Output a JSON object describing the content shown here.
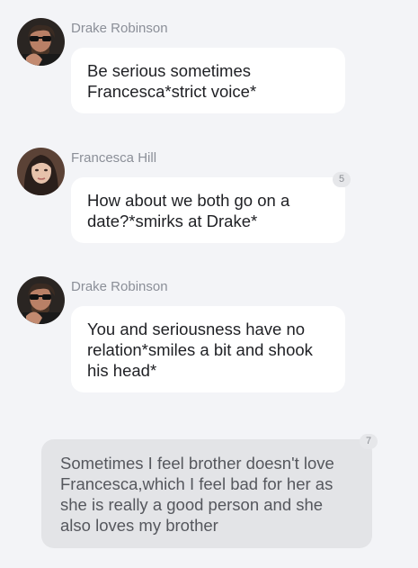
{
  "messages": [
    {
      "sender": "Drake Robinson",
      "text": "Be serious sometimes Francesca*strict voice*"
    },
    {
      "sender": "Francesca Hill",
      "text": "How about we both go on a date?*smirks at Drake*",
      "badge": "5"
    },
    {
      "sender": "Drake Robinson",
      "text": "You and seriousness have no relation*smiles a bit and shook his head*"
    }
  ],
  "narration": {
    "text": "Sometimes I feel brother doesn't love Francesca,which I feel bad for her as she is really a good person and she also loves my brother",
    "badge": "7"
  },
  "avatars": {
    "drake": {
      "icon": "male-avatar-with-sunglasses-icon"
    },
    "francesca": {
      "icon": "female-avatar-icon"
    }
  },
  "colors": {
    "background": "#f3f4f7",
    "bubble": "#ffffff",
    "narration": "#e3e4e7",
    "name": "#8b8f98"
  }
}
